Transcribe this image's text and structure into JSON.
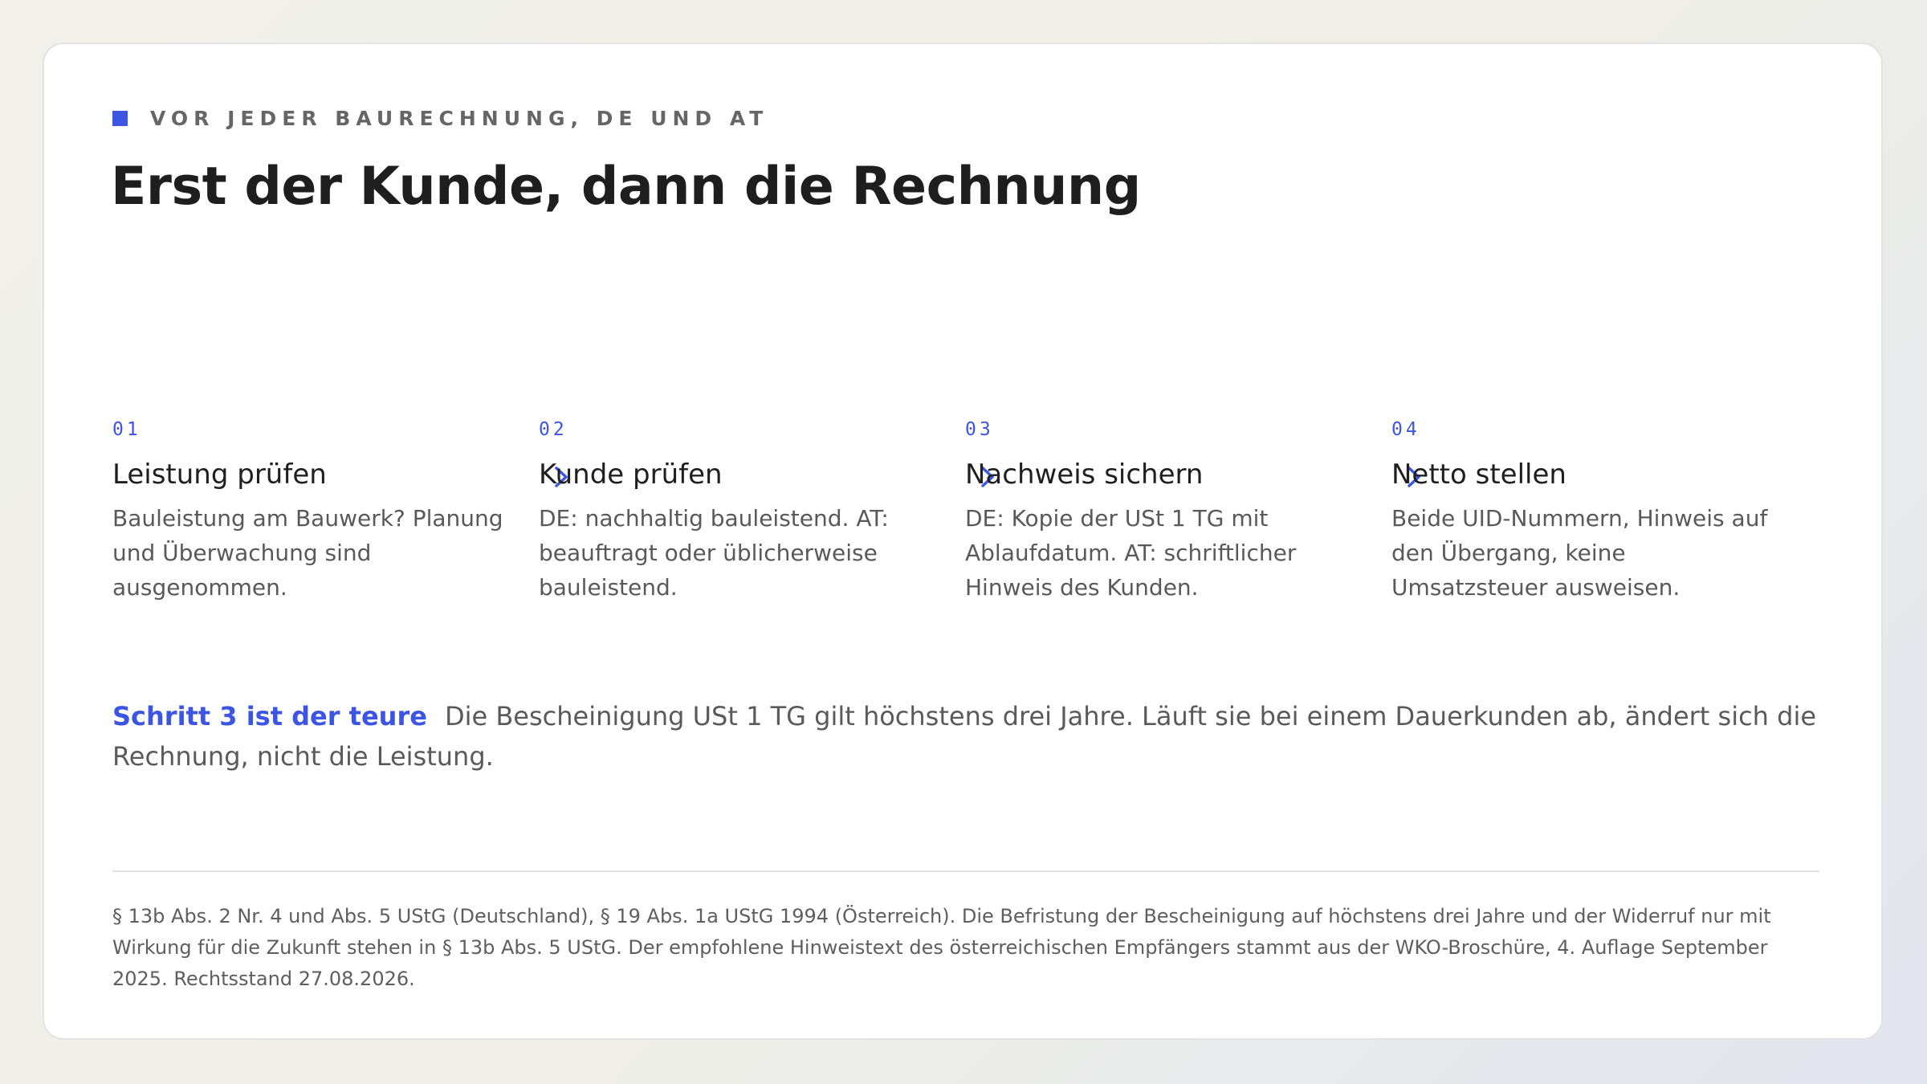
{
  "eyebrow": {
    "label": "VOR JEDER BAURECHNUNG, DE UND AT",
    "accent_color": "#3d55e3"
  },
  "headline": "Erst der Kunde, dann die Rechnung",
  "steps": [
    {
      "number": "01",
      "title": "Leistung prüfen",
      "description": "Bauleistung am Bauwerk? Planung und Überwachung sind ausgenommen."
    },
    {
      "number": "02",
      "title": "Kunde prüfen",
      "description": "DE: nachhaltig bauleistend. AT: beauftragt oder üblicherweise bauleistend."
    },
    {
      "number": "03",
      "title": "Nachweis sichern",
      "description": "DE: Kopie der USt 1 TG mit Ablaufdatum. AT: schriftlicher Hinweis des Kunden."
    },
    {
      "number": "04",
      "title": "Netto stellen",
      "description": "Beide UID-Nummern, Hinweis auf den Übergang, keine Umsatzsteuer ausweisen."
    }
  ],
  "separator_icon": "chevron-right-icon",
  "callout": {
    "lead": "Schritt 3 ist der teure",
    "text": "Die Bescheinigung USt 1 TG gilt höchstens drei Jahre. Läuft sie bei einem Dauerkunden ab, ändert sich die Rechnung, nicht die Leistung."
  },
  "footnote": "§ 13b Abs. 2 Nr. 4 und Abs. 5 UStG (Deutschland), § 19 Abs. 1a UStG 1994 (Österreich). Die Befristung der Bescheinigung auf höchstens drei Jahre und der Widerruf nur mit Wirkung für die Zukunft stehen in § 13b Abs. 5 UStG. Der empfohlene Hinweistext des österreichischen Empfängers stammt aus der WKO-Broschüre, 4. Auflage September 2025. Rechtsstand 27.08.2026.",
  "colors": {
    "accent": "#3d55e3",
    "heading": "#1e1e1e",
    "body": "#595959"
  }
}
